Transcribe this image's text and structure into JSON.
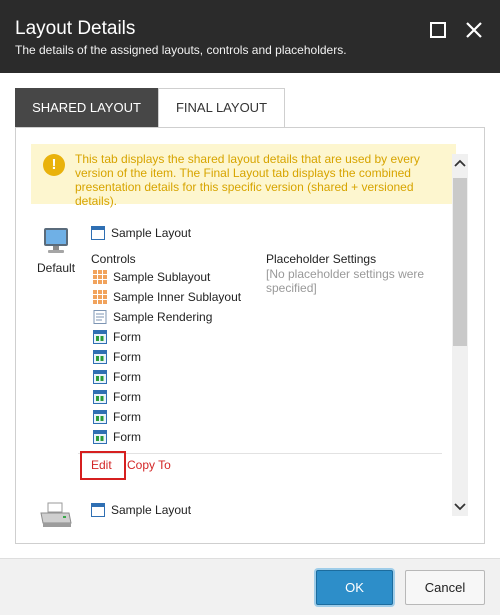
{
  "window": {
    "title": "Layout Details",
    "subtitle": "The details of the assigned layouts, controls and placeholders."
  },
  "tabs": [
    {
      "label": "SHARED LAYOUT",
      "active": true
    },
    {
      "label": "FINAL LAYOUT",
      "active": false
    }
  ],
  "warning": {
    "text": "This tab displays the shared layout details that are used by every version of the item. The Final Layout tab displays the combined presentation details for this specific version (shared + versioned details)."
  },
  "devices": [
    {
      "label": "Default",
      "icon": "monitor-icon",
      "layout": "Sample Layout",
      "controls_label": "Controls",
      "controls": [
        {
          "icon": "sublayout-icon",
          "name": "Sample Sublayout"
        },
        {
          "icon": "sublayout-icon",
          "name": "Sample Inner Sublayout"
        },
        {
          "icon": "rendering-icon",
          "name": "Sample Rendering"
        },
        {
          "icon": "form-icon",
          "name": "Form"
        },
        {
          "icon": "form-icon",
          "name": "Form"
        },
        {
          "icon": "form-icon",
          "name": "Form"
        },
        {
          "icon": "form-icon",
          "name": "Form"
        },
        {
          "icon": "form-icon",
          "name": "Form"
        },
        {
          "icon": "form-icon",
          "name": "Form"
        }
      ],
      "placeholder_label": "Placeholder Settings",
      "placeholder_empty": "[No placeholder settings were specified]",
      "edit_label": "Edit",
      "copy_label": "Copy To"
    },
    {
      "label": "",
      "icon": "printer-icon",
      "layout": "Sample Layout"
    }
  ],
  "footer": {
    "ok_label": "OK",
    "cancel_label": "Cancel"
  },
  "colors": {
    "header_bg": "#2b2b2b",
    "active_tab_bg": "#474747",
    "warning_bg": "#fdf6cf",
    "warning_text": "#d7a400",
    "link_red": "#d32626",
    "ok_blue": "#2d8ec9"
  }
}
